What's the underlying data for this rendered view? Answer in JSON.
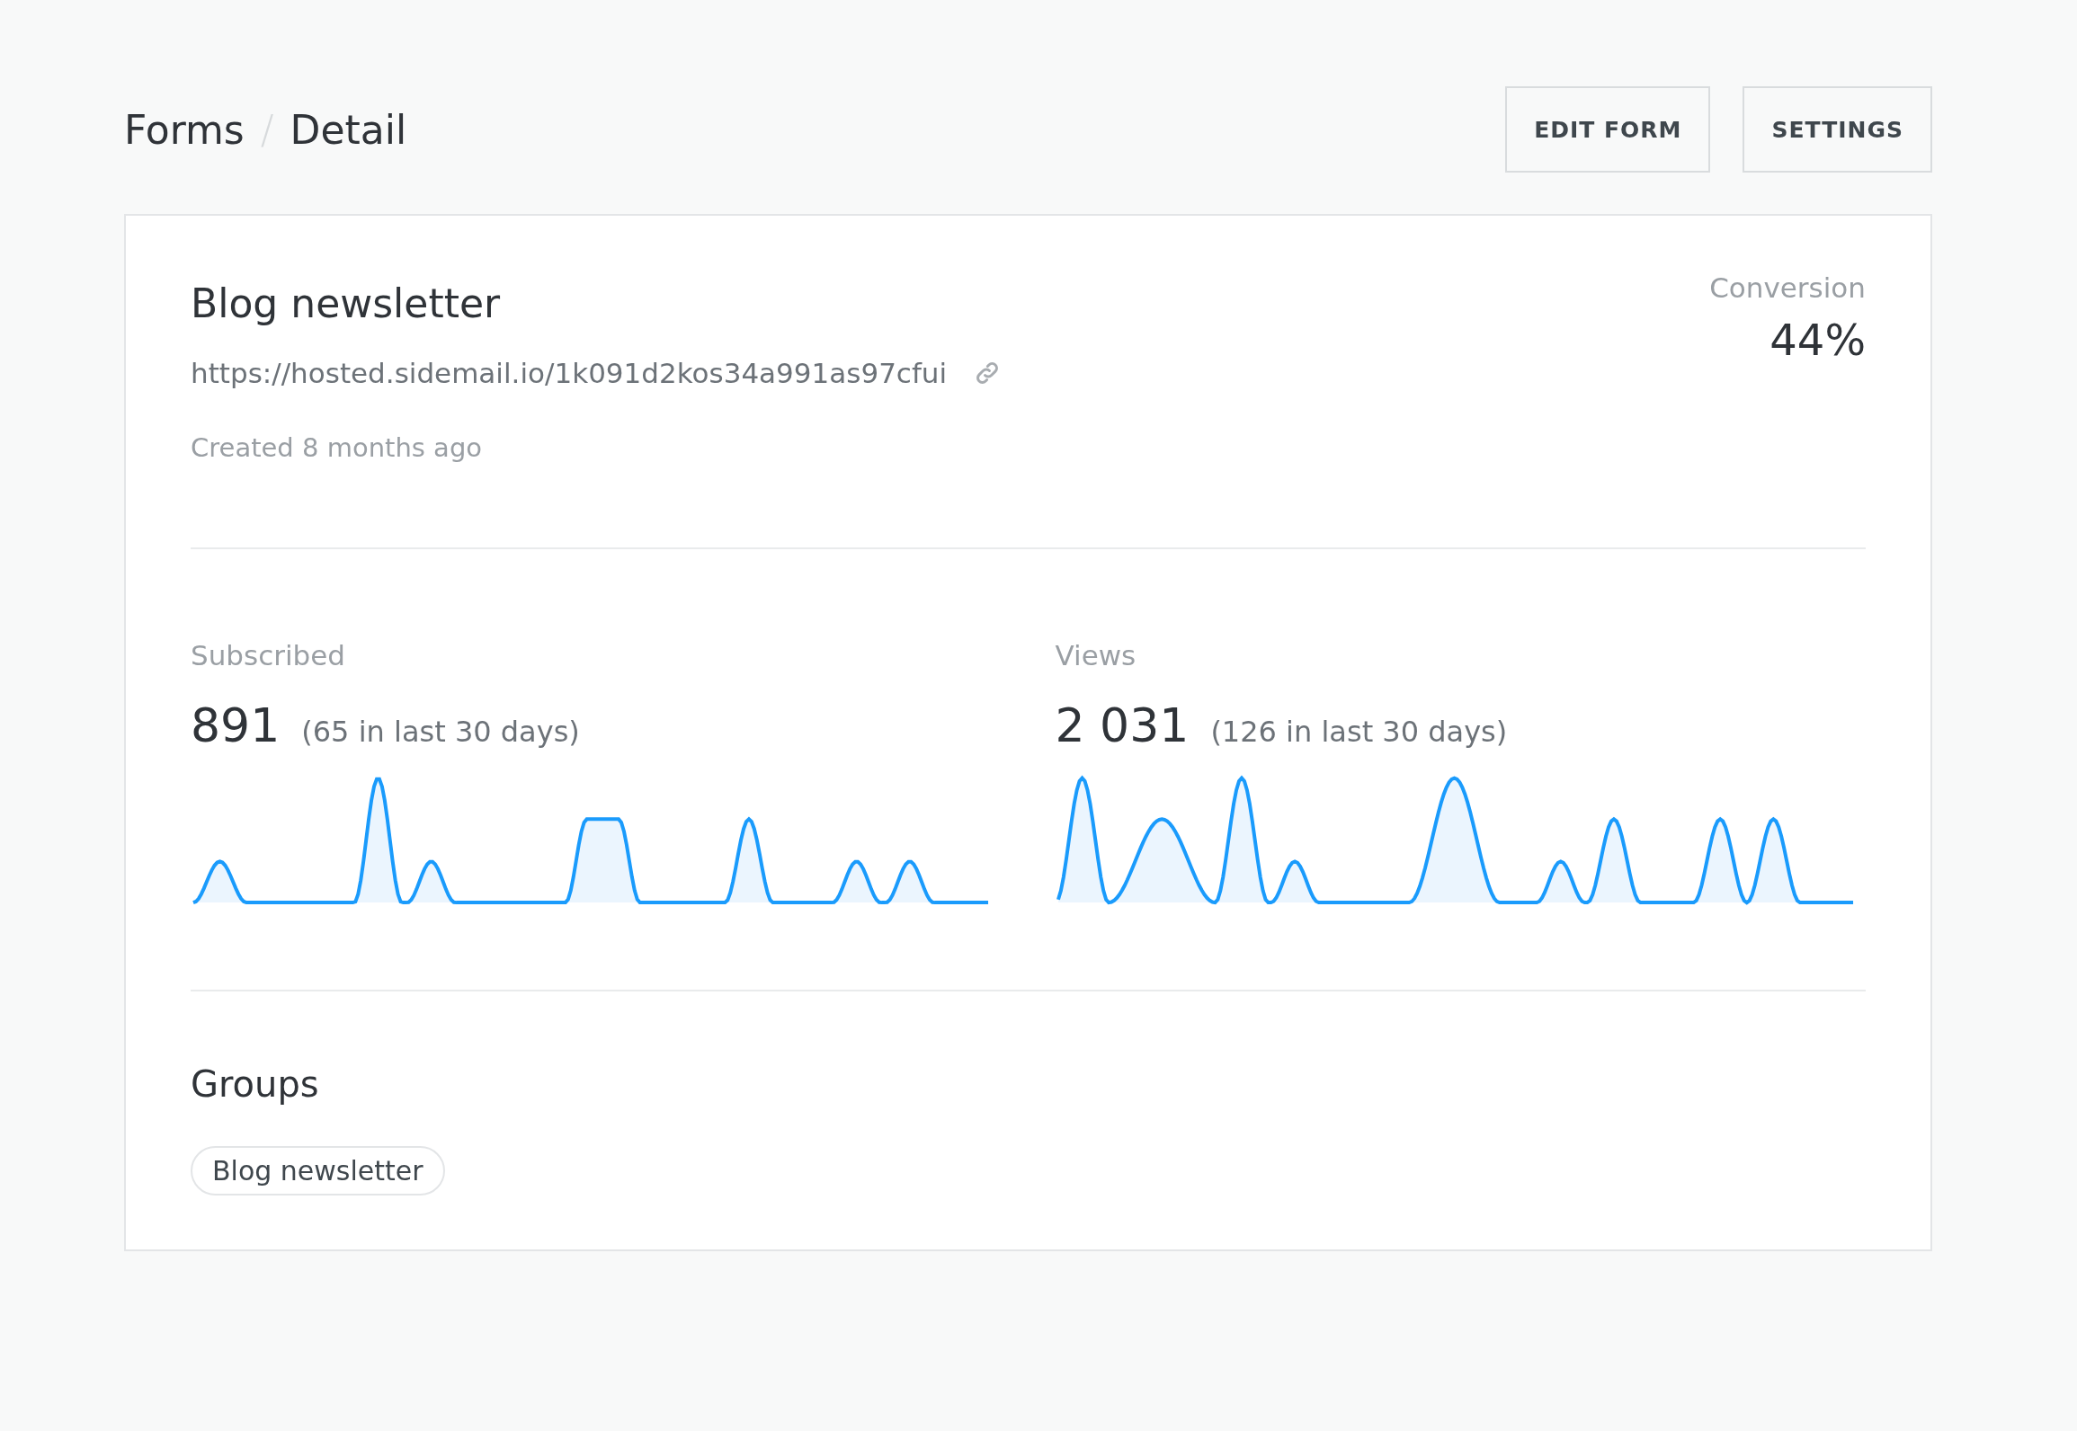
{
  "breadcrumb": {
    "items": [
      "Forms",
      "Detail"
    ],
    "separator": "/"
  },
  "buttons": [
    "EDIT FORM",
    "SETTINGS"
  ],
  "form": {
    "title": "Blog newsletter",
    "url": "https://hosted.sidemail.io/1k091d2kos34a991as97cfui",
    "created": "Created 8 months ago",
    "conversion": {
      "label": "Conversion",
      "value": "44%"
    }
  },
  "stats": [
    {
      "label": "Subscribed",
      "value": "891",
      "note": "(65 in last 30 days)"
    },
    {
      "label": "Views",
      "value": "2 031",
      "note": "(126 in last 30 days)"
    }
  ],
  "groups": {
    "title": "Groups",
    "tags": [
      "Blog newsletter"
    ]
  }
}
